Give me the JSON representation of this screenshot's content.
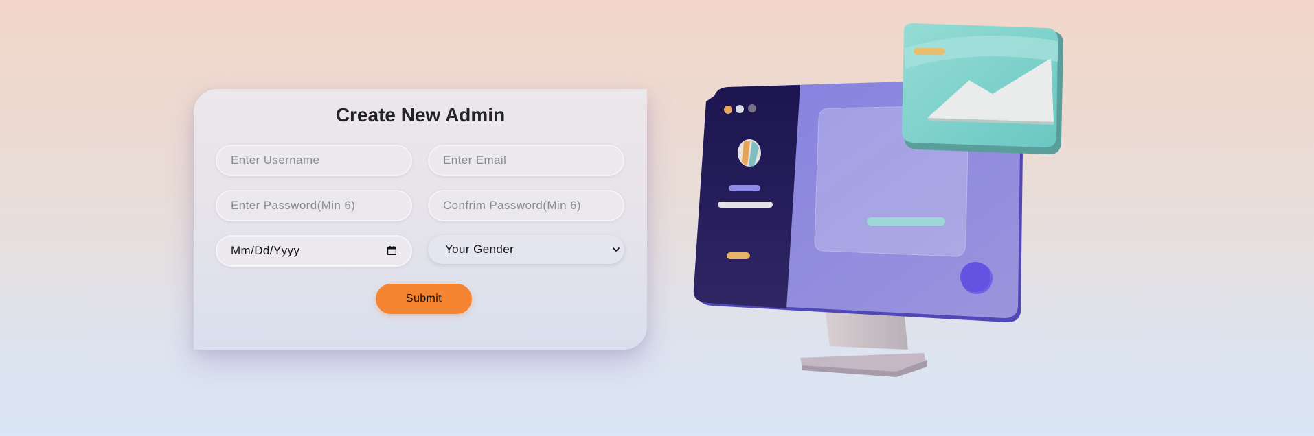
{
  "form": {
    "title": "Create New Admin",
    "username_placeholder": "Enter Username",
    "email_placeholder": "Enter Email",
    "password_placeholder": "Enter Password(Min 6)",
    "confirm_password_placeholder": "Confrim Password(Min 6)",
    "date_value": "Mm/Dd/Yyyy",
    "date_icon": "calendar-icon",
    "gender_selected": "Your Gender",
    "gender_icon": "chevron-down-icon",
    "submit_label": "Submit"
  },
  "colors": {
    "accent": "#f48430",
    "monitor_primary": "#8c87e0",
    "monitor_sidebar": "#211b58",
    "envelope": "#7fd3cd"
  }
}
